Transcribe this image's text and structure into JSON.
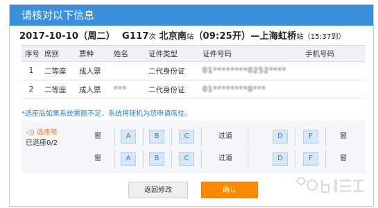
{
  "dialog": {
    "title": "请核对以下信息"
  },
  "trip": {
    "date": "2017-10-10（周二）",
    "train": "G117",
    "train_suffix": "次",
    "from": "北京南",
    "from_suffix": "站",
    "depart": "（09:25开）—",
    "to": "上海虹桥",
    "to_suffix": "站",
    "arrive": "（15:37到）"
  },
  "table": {
    "headers": [
      "序号",
      "席别",
      "票种",
      "姓名",
      "证件类型",
      "证件号码",
      "手机号码"
    ],
    "rows": [
      {
        "index": "1",
        "seat_class": "二等座",
        "ticket_type": "成人票",
        "name": "",
        "id_type": "二代身份证",
        "id_number": "01********0252****",
        "phone": ""
      },
      {
        "index": "2",
        "seat_class": "二等座",
        "ticket_type": "成人票",
        "name": "***",
        "id_type": "二代身份证",
        "id_number": "01********0***",
        "phone": ""
      }
    ]
  },
  "note": "*选座后如果系统票额不足，系统将随机为您申请席位。",
  "seat_select": {
    "label": "选座喽",
    "count": "已选座0/2",
    "window_label": "窗",
    "aisle_label": "过道",
    "rows": [
      {
        "left": [
          "A",
          "B",
          "C"
        ],
        "right": [
          "D",
          "F"
        ]
      },
      {
        "left": [
          "A",
          "B",
          "C"
        ],
        "right": [
          "D",
          "F"
        ]
      }
    ]
  },
  "buttons": {
    "back": "返回修改",
    "confirm": "确认"
  },
  "colors": {
    "title_bar": "#3c8fdc",
    "confirm": "#ff8a00",
    "note": "#2c7fd1",
    "seat": "#d8e7f5"
  }
}
